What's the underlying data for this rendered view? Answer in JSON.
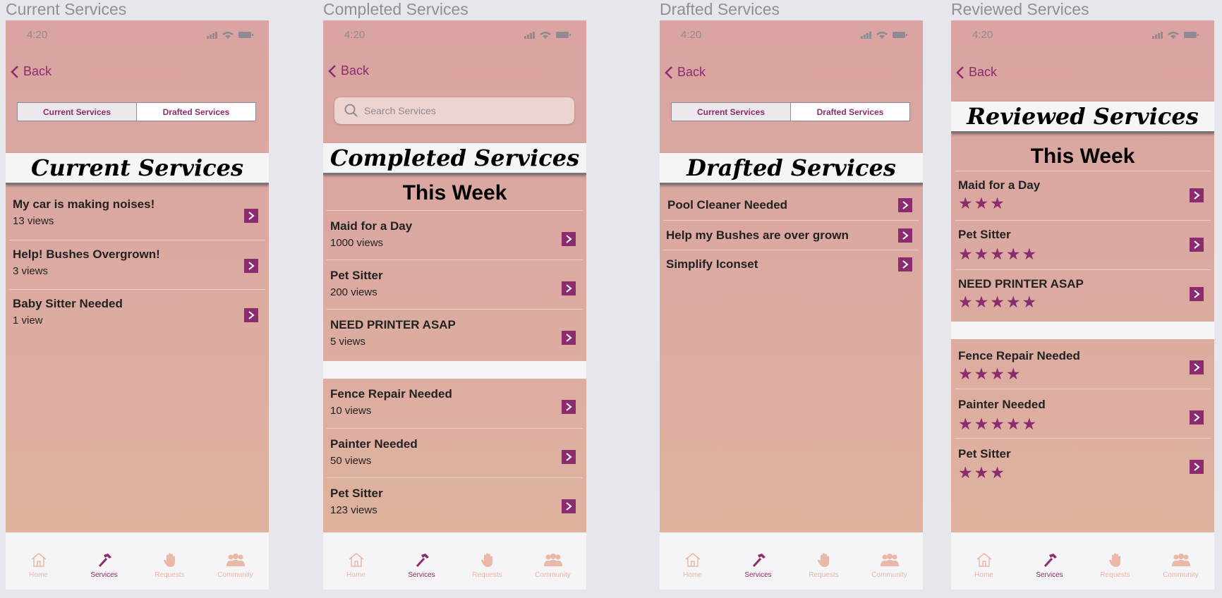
{
  "colors": {
    "accent": "#8b2c6e",
    "banner_bg": "#f6f4f6",
    "inactive_tab": "#e9b8a6"
  },
  "status": {
    "time": "4:20"
  },
  "common": {
    "back": "Back",
    "search_placeholder": "Search Services",
    "seg_current": "Current Services",
    "seg_drafted": "Drafted Services"
  },
  "tabs": {
    "home": "Home",
    "services": "Services",
    "requests": "Requests",
    "community": "Community"
  },
  "screens": {
    "current": {
      "frame_title": "Current Services",
      "banner": "Current Services",
      "items": [
        {
          "title": "My car is making noises!",
          "views": "13 views"
        },
        {
          "title": "Help! Bushes Overgrown!",
          "views": "3 views"
        },
        {
          "title": "Baby Sitter Needed",
          "views": "1 view"
        }
      ]
    },
    "completed": {
      "frame_title": "Completed Services",
      "banner": "Completed Services",
      "week": "This Week",
      "items": [
        {
          "title": "Maid for a Day",
          "views": "1000 views"
        },
        {
          "title": "Pet Sitter",
          "views": "200 views"
        },
        {
          "title": "NEED PRINTER ASAP",
          "views": "5 views"
        }
      ],
      "older": [
        {
          "title": "Fence Repair Needed",
          "views": "10 views"
        },
        {
          "title": "Painter Needed",
          "views": "50 views"
        },
        {
          "title": "Pet Sitter",
          "views": "123 views"
        }
      ]
    },
    "drafted": {
      "frame_title": "Drafted Services",
      "banner": "Drafted Services",
      "items": [
        {
          "title": "Pool Cleaner Needed"
        },
        {
          "title": "Help my Bushes are over grown"
        },
        {
          "title": "Simplify Iconset"
        }
      ]
    },
    "reviewed": {
      "frame_title": "Reviewed Services",
      "banner": "Reviewed Services",
      "week": "This Week",
      "items": [
        {
          "title": "Maid for a Day",
          "rating": 3
        },
        {
          "title": "Pet Sitter",
          "rating": 5
        },
        {
          "title": "NEED PRINTER ASAP",
          "rating": 5
        }
      ],
      "older": [
        {
          "title": "Fence Repair Needed",
          "rating": 4
        },
        {
          "title": "Painter Needed",
          "rating": 5
        },
        {
          "title": "Pet Sitter",
          "rating": 3
        }
      ]
    }
  }
}
